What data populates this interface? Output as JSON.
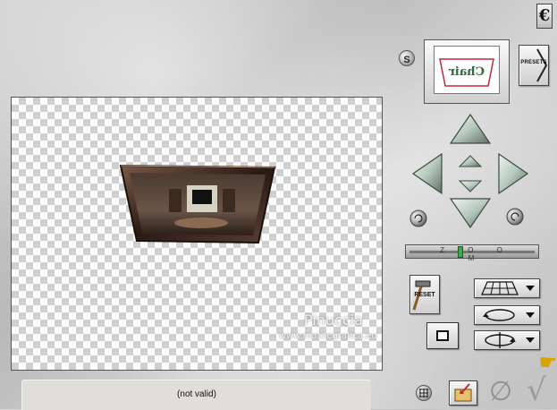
{
  "app": {
    "logo_glyph": "€"
  },
  "thumbnail": {
    "text": "Chair"
  },
  "s_button": {
    "label": "S"
  },
  "presets_button": {
    "label": "PRESETS"
  },
  "zoom": {
    "label": "Z O O M",
    "value_fraction": 0.4
  },
  "reset_button": {
    "label": "RESET"
  },
  "status_bar": {
    "text": "(not valid)"
  },
  "watermark": {
    "name": "Pinuccia",
    "url": "www.matitegrafica.eu"
  },
  "icons": {
    "grid": "grid-icon",
    "open": "open-folder-icon",
    "cancel": "cancel-icon",
    "ok": "checkmark-icon",
    "help": "help-hand-icon"
  },
  "colors": {
    "zoom_thumb": "#3fa64d",
    "arrow": "#b9ccc0",
    "frame": "#3c2a22"
  }
}
